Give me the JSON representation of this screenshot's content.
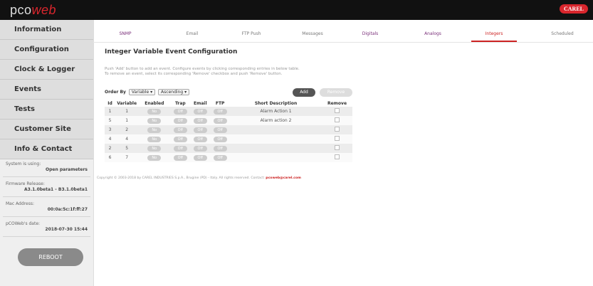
{
  "header": {
    "logo_pco": "pco",
    "logo_web": "web",
    "brand": "CAREL"
  },
  "sidebar": {
    "nav": [
      "Information",
      "Configuration",
      "Clock & Logger",
      "Events",
      "Tests",
      "Customer Site",
      "Info & Contact"
    ],
    "system_label": "System is using:",
    "system_value": "Open parameters",
    "firmware_label": "Firmware Release:",
    "firmware_value": "A3.1.0beta1 - B3.1.0beta1",
    "mac_label": "Mac Address:",
    "mac_value": "00:0a:5c:1f:ff:27",
    "date_label": "pCOWeb's date:",
    "date_value": "2018-07-30 15:44",
    "reboot": "REBOOT"
  },
  "tabs": [
    {
      "label": "SNMP",
      "active": false
    },
    {
      "label": "Email",
      "active": false
    },
    {
      "label": "FTP Push",
      "active": false
    },
    {
      "label": "Messages",
      "active": false
    },
    {
      "label": "Digitals",
      "active": false
    },
    {
      "label": "Analogs",
      "active": false
    },
    {
      "label": "Integers",
      "active": true
    },
    {
      "label": "Scheduled",
      "active": false
    }
  ],
  "colors": {
    "accent": "#d9262d",
    "tab_active": "#c22222",
    "tab_link": "#7a2f7a",
    "pill": "#cccccc"
  },
  "page": {
    "title": "Integer Variable Event Configuration",
    "desc1": "Push 'Add' button to add an event. Configure events by clicking corresponding entries in below table.",
    "desc2": "To remove an event, select its corresponding 'Remove' checkbox and push 'Remove' button."
  },
  "controls": {
    "order_by_label": "Order By",
    "order_by_value": "Variable",
    "order_dir_value": "Ascending",
    "add": "Add",
    "remove": "Remove"
  },
  "table": {
    "headers": [
      "Id",
      "Variable",
      "Enabled",
      "Trap",
      "Email",
      "FTP",
      "Short Description",
      "Remove"
    ],
    "rows": [
      {
        "id": "1",
        "variable": "1",
        "enabled": "No",
        "trap": "Off",
        "email": "Off",
        "ftp": "Off",
        "desc": "Alarm Action 1"
      },
      {
        "id": "5",
        "variable": "1",
        "enabled": "No",
        "trap": "Off",
        "email": "Off",
        "ftp": "Off",
        "desc": "Alarm action 2"
      },
      {
        "id": "3",
        "variable": "2",
        "enabled": "No",
        "trap": "Off",
        "email": "Off",
        "ftp": "Off",
        "desc": ""
      },
      {
        "id": "4",
        "variable": "4",
        "enabled": "No",
        "trap": "Off",
        "email": "Off",
        "ftp": "Off",
        "desc": ""
      },
      {
        "id": "2",
        "variable": "5",
        "enabled": "No",
        "trap": "Off",
        "email": "Off",
        "ftp": "Off",
        "desc": ""
      },
      {
        "id": "6",
        "variable": "7",
        "enabled": "No",
        "trap": "Off",
        "email": "Off",
        "ftp": "Off",
        "desc": ""
      }
    ]
  },
  "footer": {
    "text": "Copyright © 2003-2018 by CAREL INDUSTRIES S.p.A., Brugine (PD) - Italy. All rights reserved. Contact:",
    "contact": "pcoweb@carel.com"
  }
}
